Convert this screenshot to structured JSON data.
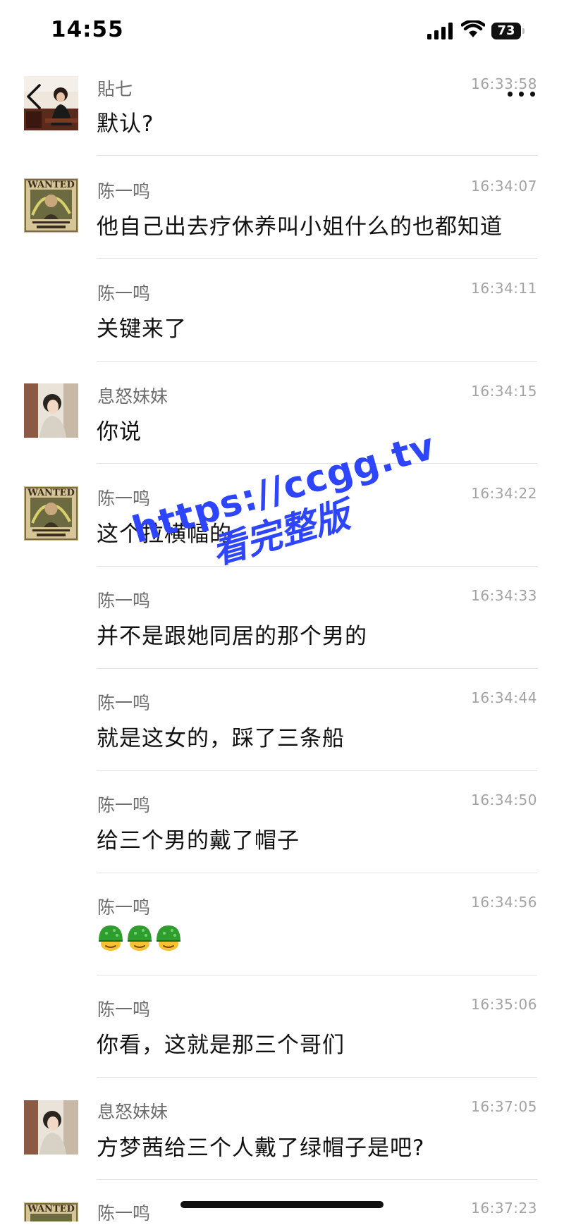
{
  "status_bar": {
    "time": "14:55",
    "battery": "73"
  },
  "colors": {
    "watermark": "#2d45ff",
    "sender_name": "#6d6d6d",
    "timestamp": "#a3a3a3",
    "divider": "#e3e3e3"
  },
  "header": {
    "back_icon": "chevron-left-icon",
    "more_icon": "more-dots-icon"
  },
  "messages": [
    {
      "sender": "貼七",
      "time": "16:33:58",
      "text": "默认?"
    },
    {
      "sender": "陈一鸣",
      "time": "16:34:07",
      "text": "他自己出去疗休养叫小姐什么的也都知道"
    },
    {
      "sender": "陈一鸣",
      "time": "16:34:11",
      "text": "关键来了"
    },
    {
      "sender": "息怒妹妹",
      "time": "16:34:15",
      "text": "你说"
    },
    {
      "sender": "陈一鸣",
      "time": "16:34:22",
      "text": "这个拉横幅的"
    },
    {
      "sender": "陈一鸣",
      "time": "16:34:33",
      "text": "并不是跟她同居的那个男的"
    },
    {
      "sender": "陈一鸣",
      "time": "16:34:44",
      "text": "就是这女的，踩了三条船"
    },
    {
      "sender": "陈一鸣",
      "time": "16:34:50",
      "text": "给三个男的戴了帽子"
    },
    {
      "sender": "陈一鸣",
      "time": "16:34:56",
      "emoji": "green-helmet-face-icon x3"
    },
    {
      "sender": "陈一鸣",
      "time": "16:35:06",
      "text": "你看，这就是那三个哥们"
    },
    {
      "sender": "息怒妹妹",
      "time": "16:37:05",
      "text": "方梦茜给三个人戴了绿帽子是吧?"
    },
    {
      "sender": "陈一鸣",
      "time": "16:37:23"
    }
  ],
  "watermark": {
    "url": "https://ccgg.tv",
    "cta": "看完整版"
  }
}
